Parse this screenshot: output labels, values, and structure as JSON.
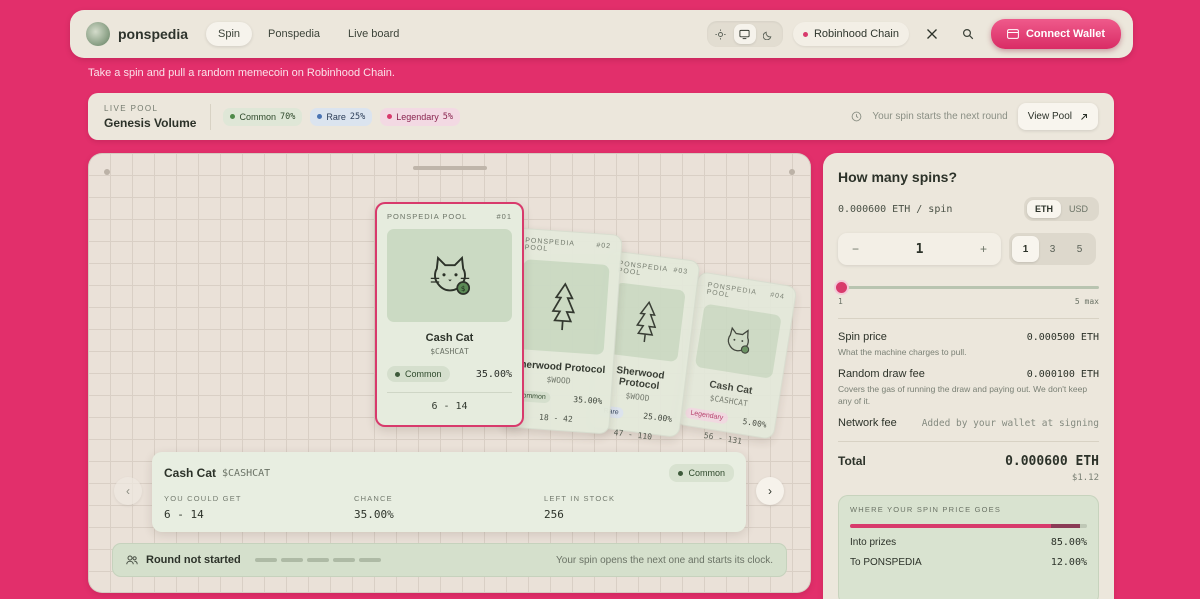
{
  "nav": {
    "brand": "ponspedia",
    "links": [
      {
        "label": "Spin",
        "active": true
      },
      {
        "label": "Ponspedia",
        "active": false
      },
      {
        "label": "Live board",
        "active": false
      }
    ],
    "theme": {
      "options": [
        "sun-icon",
        "monitor-icon",
        "moon-icon"
      ],
      "active": "monitor-icon"
    },
    "chain": "Robinhood Chain",
    "connect": "Connect Wallet"
  },
  "tagline": "Take a spin and pull a random memecoin on Robinhood Chain.",
  "pool": {
    "eyebrow": "LIVE POOL",
    "name": "Genesis Volume",
    "chips": [
      {
        "label": "Common",
        "pct": "70%",
        "kind": "common"
      },
      {
        "label": "Rare",
        "pct": "25%",
        "kind": "rare"
      },
      {
        "label": "Legendary",
        "pct": "5%",
        "kind": "legend"
      }
    ],
    "note": "Your spin starts the next round",
    "view": "View Pool"
  },
  "cards": {
    "main": {
      "pool": "PONSPEDIA POOL",
      "num": "#01",
      "name": "Cash Cat",
      "ticker": "$CASHCAT",
      "rarity": "Common",
      "chance": "35.00%",
      "range": "6 - 14"
    },
    "c2": {
      "pool": "PONSPEDIA POOL",
      "num": "#02",
      "name": "Sherwood Protocol",
      "ticker": "$WOOD",
      "rarity": "Common",
      "chance": "35.00%",
      "range": "18 - 42"
    },
    "c3": {
      "pool": "PONSPEDIA POOL",
      "num": "#03",
      "name": "Sherwood Protocol",
      "ticker": "$WOOD",
      "rarity": "Rare",
      "chance": "25.00%",
      "range": "47 - 110"
    },
    "c4": {
      "pool": "PONSPEDIA POOL",
      "num": "#04",
      "name": "Cash Cat",
      "ticker": "$CASHCAT",
      "rarity": "Legendary",
      "chance": "5.00%",
      "range": "56 - 131"
    }
  },
  "detail": {
    "name": "Cash Cat",
    "ticker": "$CASHCAT",
    "badge": "Common",
    "cols": [
      {
        "label": "YOU COULD GET",
        "value": "6 - 14"
      },
      {
        "label": "CHANCE",
        "value": "35.00%"
      },
      {
        "label": "LEFT IN STOCK",
        "value": "256"
      }
    ]
  },
  "round": {
    "title": "Round not started",
    "note": "Your spin opens the next one and starts its clock."
  },
  "side": {
    "title": "How many spins?",
    "per_spin": "0.000600 ETH / spin",
    "currency": [
      {
        "label": "ETH",
        "on": true
      },
      {
        "label": "USD",
        "on": false
      }
    ],
    "minus": "−",
    "plus": "+",
    "qty": "1",
    "presets": [
      {
        "label": "1",
        "on": true
      },
      {
        "label": "3",
        "on": false
      },
      {
        "label": "5",
        "on": false
      }
    ],
    "slider_min": "1",
    "slider_max": "5 max",
    "slider_value": 1,
    "fees": [
      {
        "name": "Spin price",
        "value": "0.000500 ETH",
        "desc": "What the machine charges to pull."
      },
      {
        "name": "Random draw fee",
        "value": "0.000100 ETH",
        "desc": "Covers the gas of running the draw and paying out. We don't keep any of it."
      },
      {
        "name": "Network fee",
        "value": "Added by your wallet at signing",
        "desc": ""
      }
    ],
    "total_label": "Total",
    "total_value": "0.000600 ETH",
    "total_usd": "$1.12",
    "split": {
      "label": "WHERE YOUR SPIN PRICE GOES",
      "rows": [
        {
          "name": "Into prizes",
          "value": "85.00%"
        },
        {
          "name": "To PONSPEDIA",
          "value": "12.00%"
        }
      ]
    }
  }
}
